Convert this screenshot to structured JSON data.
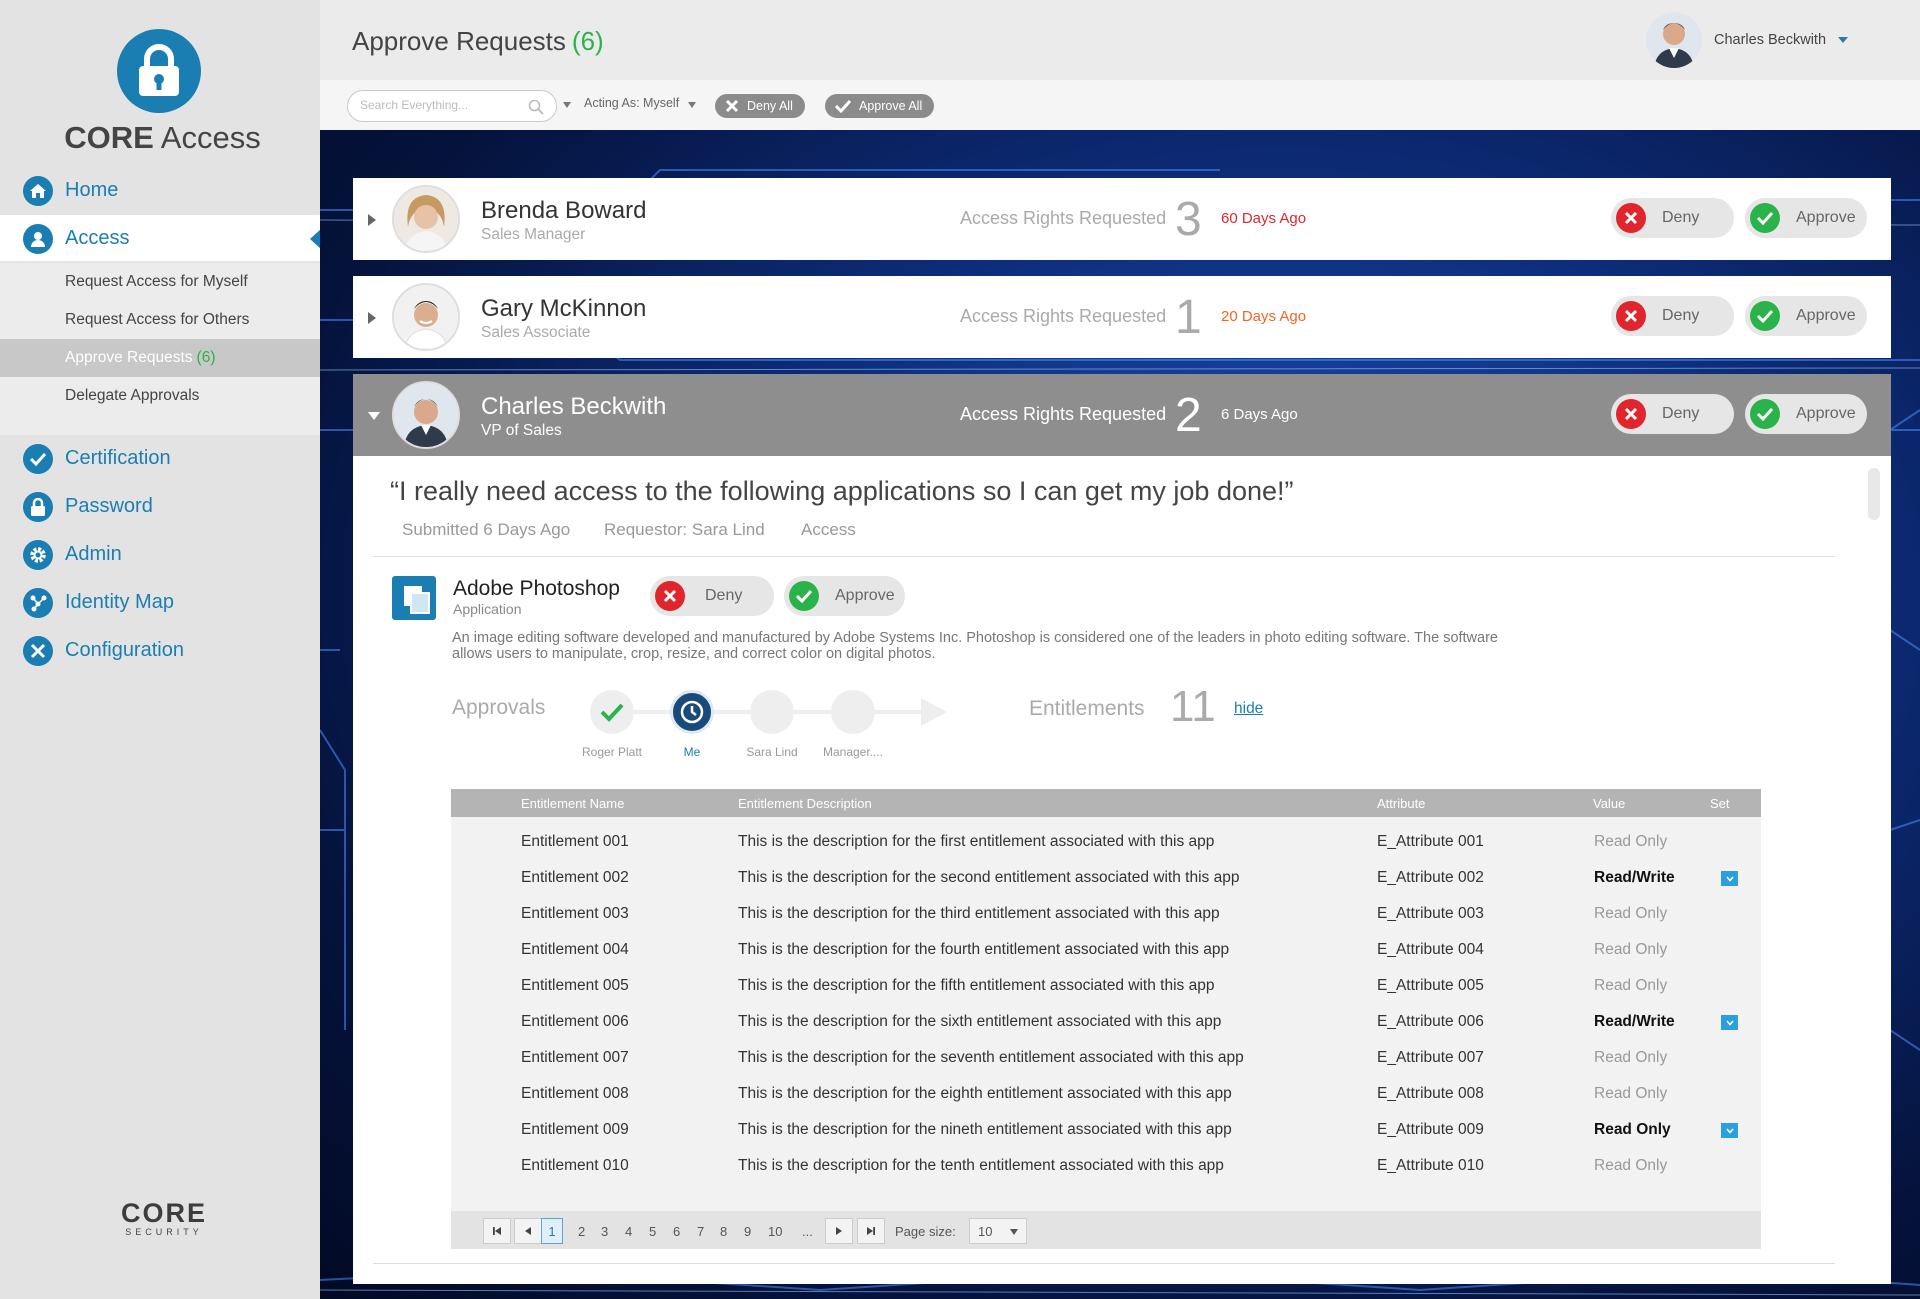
{
  "brand": {
    "name_bold": "CORE",
    "name_rest": " Access",
    "footer_logo": "CORE",
    "footer_sub": "SECURITY"
  },
  "nav": {
    "home": "Home",
    "access": "Access",
    "sub": [
      {
        "label": "Request Access for Myself"
      },
      {
        "label": "Request Access for Others"
      },
      {
        "label": "Approve Requests",
        "count": "(6)"
      },
      {
        "label": "Delegate Approvals"
      }
    ],
    "certification": "Certification",
    "password": "Password",
    "admin": "Admin",
    "identity_map": "Identity Map",
    "configuration": "Configuration"
  },
  "header": {
    "title": "Approve Requests",
    "count": "(6)",
    "user": "Charles Beckwith"
  },
  "toolbar": {
    "search_placeholder": "Search Everything...",
    "acting_as": "Acting As: Myself",
    "deny_all": "Deny All",
    "approve_all": "Approve All"
  },
  "requests": [
    {
      "name": "Brenda Boward",
      "role": "Sales Manager",
      "label": "Access Rights Requested",
      "count": "3",
      "ago": "60 Days Ago",
      "ago_color": "#e0262c"
    },
    {
      "name": "Gary McKinnon",
      "role": "Sales Associate",
      "label": "Access Rights Requested",
      "count": "1",
      "ago": "20 Days Ago",
      "ago_color": "#f26522"
    },
    {
      "name": "Charles Beckwith",
      "role": "VP of Sales",
      "label": "Access Rights Requested",
      "count": "2",
      "ago": "6 Days Ago",
      "ago_color": "#ffffff"
    }
  ],
  "buttons": {
    "deny": "Deny",
    "approve": "Approve"
  },
  "detail": {
    "quote": "“I really need access to the following applications so I can get my job done!”",
    "submitted": "Submitted 6 Days Ago",
    "requestor": "Requestor: Sara Lind",
    "type": "Access",
    "app_name": "Adobe Photoshop",
    "app_type": "Application",
    "app_desc": "An image editing software developed and manufactured by Adobe Systems Inc. Photoshop is considered one of the leaders in photo editing software. The software allows users to manipulate, crop, resize, and correct color on digital  photos.",
    "approvals_label": "Approvals",
    "steps": [
      "Roger Platt",
      "Me",
      "Sara Lind",
      "Manager...."
    ],
    "entitlements_label": "Entitlements",
    "entitlements_count": "11",
    "hide": "hide"
  },
  "table": {
    "headers": [
      "Entitlement Name",
      "Entitlement Description",
      "Attribute",
      "Value",
      "Set"
    ],
    "rows": [
      {
        "name": "Entitlement 001",
        "desc": "This is the description for the first entitlement associated with this app",
        "attr": "E_Attribute 001",
        "value": "Read Only",
        "set": false
      },
      {
        "name": "Entitlement 002",
        "desc": "This is the description for the second entitlement associated with this app",
        "attr": "E_Attribute 002",
        "value": "Read/Write",
        "set": true
      },
      {
        "name": "Entitlement 003",
        "desc": "This is the description for the third entitlement associated with this app",
        "attr": "E_Attribute 003",
        "value": "Read Only",
        "set": false
      },
      {
        "name": "Entitlement 004",
        "desc": "This is the description for the fourth entitlement associated with this app",
        "attr": "E_Attribute 004",
        "value": "Read Only",
        "set": false
      },
      {
        "name": "Entitlement 005",
        "desc": "This is the description for the fifth entitlement associated with this app",
        "attr": "E_Attribute 005",
        "value": "Read Only",
        "set": false
      },
      {
        "name": "Entitlement 006",
        "desc": "This is the description for the sixth entitlement associated with this app",
        "attr": "E_Attribute 006",
        "value": "Read/Write",
        "set": true
      },
      {
        "name": "Entitlement 007",
        "desc": "This is the description for the seventh entitlement associated with this app",
        "attr": "E_Attribute 007",
        "value": "Read Only",
        "set": false
      },
      {
        "name": "Entitlement 008",
        "desc": "This is the description for the eighth entitlement associated with this app",
        "attr": "E_Attribute 008",
        "value": "Read Only",
        "set": false
      },
      {
        "name": "Entitlement 009",
        "desc": "This is the description for the nineth entitlement associated with this app",
        "attr": "E_Attribute 009",
        "value": "Read Only",
        "set": true
      },
      {
        "name": "Entitlement 010",
        "desc": "This is the description for the tenth entitlement associated with this app",
        "attr": "E_Attribute 010",
        "value": "Read Only",
        "set": false
      }
    ],
    "pages": [
      "1",
      "2",
      "3",
      "4",
      "5",
      "6",
      "7",
      "8",
      "9",
      "10",
      "..."
    ],
    "current_page": "1",
    "page_size_label": "Page size:",
    "page_size": "10"
  },
  "colors": {
    "brand_blue": "#1b7eb2",
    "approve_green": "#2bb34b",
    "deny_red": "#e0262c"
  }
}
